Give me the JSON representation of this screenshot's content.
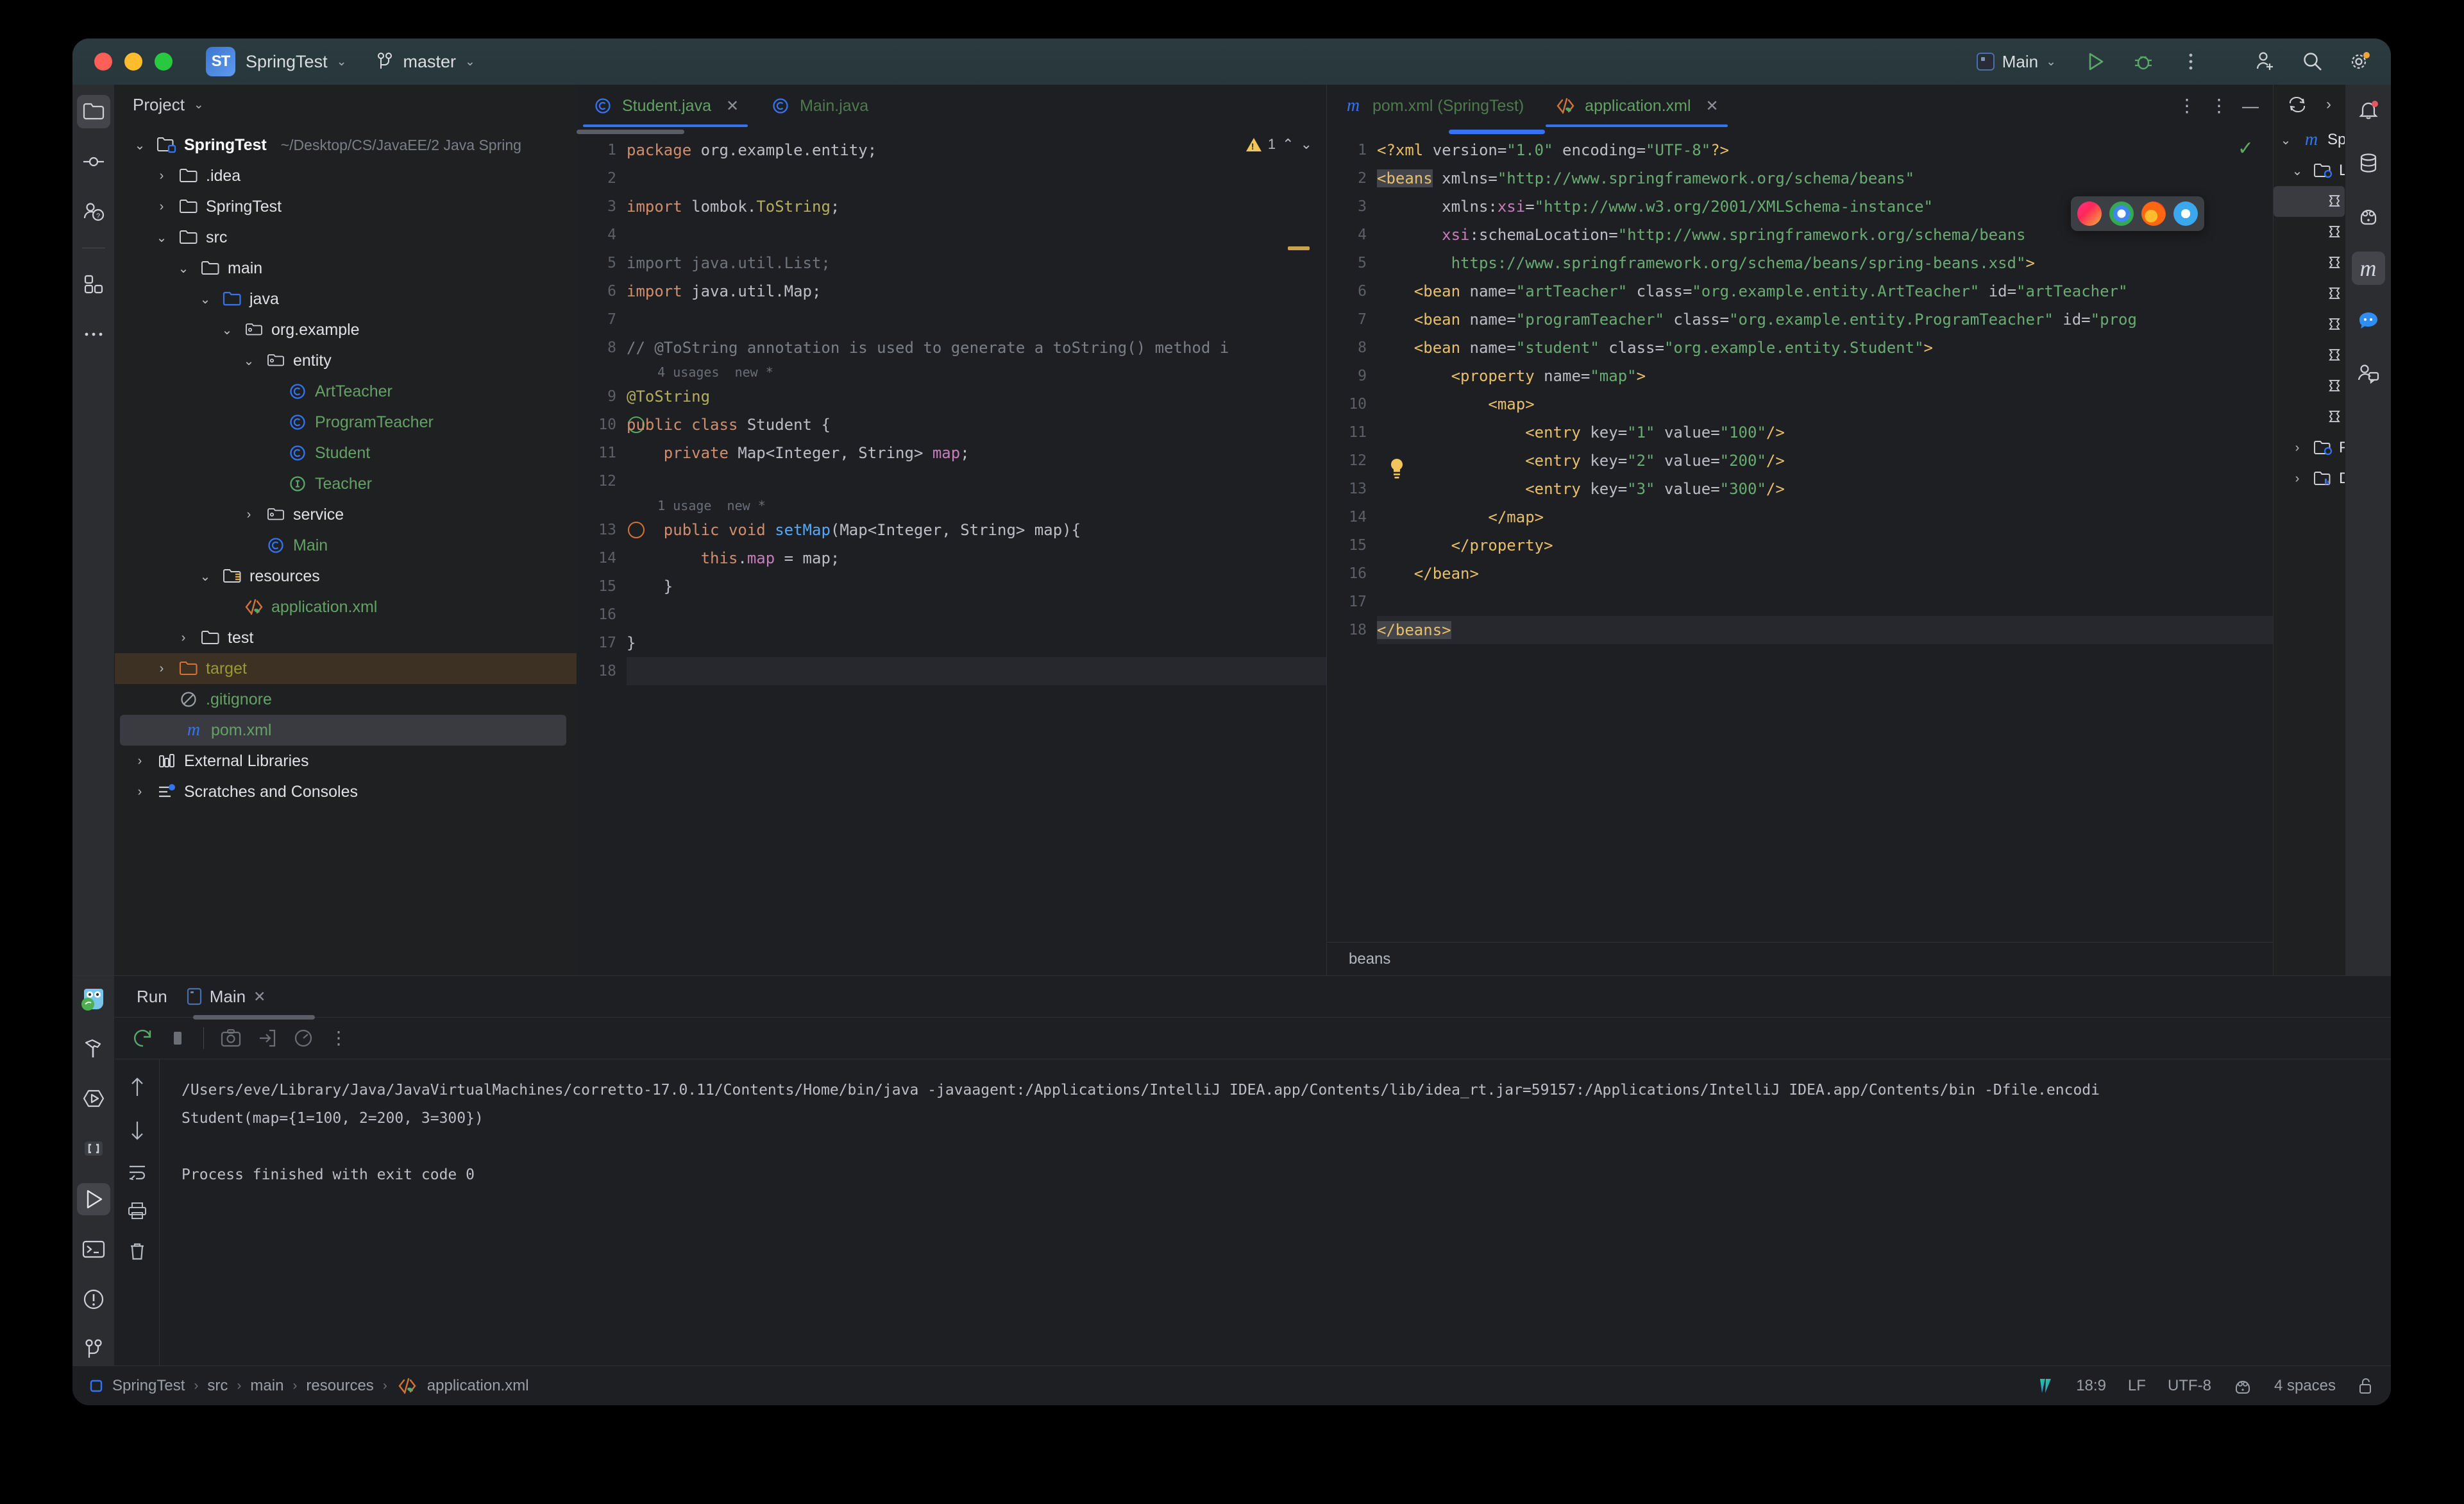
{
  "window": {
    "project_name": "SpringTest",
    "project_badge": "ST",
    "branch": "master",
    "run_config": "Main"
  },
  "project_panel": {
    "header": "Project",
    "tree": [
      {
        "label": "SpringTest",
        "path": "~/Desktop/CS/JavaEE/2 Java Spring",
        "depth": 0,
        "arrow": "v",
        "icon": "module-folder-icon",
        "style": "bold"
      },
      {
        "label": ".idea",
        "path": "",
        "depth": 1,
        "arrow": ">",
        "icon": "folder-icon",
        "style": "plain"
      },
      {
        "label": "SpringTest",
        "path": "",
        "depth": 1,
        "arrow": ">",
        "icon": "folder-icon",
        "style": "plain"
      },
      {
        "label": "src",
        "path": "",
        "depth": 1,
        "arrow": "v",
        "icon": "folder-icon",
        "style": "plain"
      },
      {
        "label": "main",
        "path": "",
        "depth": 2,
        "arrow": "v",
        "icon": "folder-icon",
        "style": "plain"
      },
      {
        "label": "java",
        "path": "",
        "depth": 3,
        "arrow": "v",
        "icon": "source-folder-icon",
        "style": "plain"
      },
      {
        "label": "org.example",
        "path": "",
        "depth": 4,
        "arrow": "v",
        "icon": "package-icon",
        "style": "plain"
      },
      {
        "label": "entity",
        "path": "",
        "depth": 5,
        "arrow": "v",
        "icon": "package-icon",
        "style": "plain"
      },
      {
        "label": "ArtTeacher",
        "path": "",
        "depth": 6,
        "arrow": "",
        "icon": "class-icon",
        "style": "green"
      },
      {
        "label": "ProgramTeacher",
        "path": "",
        "depth": 6,
        "arrow": "",
        "icon": "class-icon",
        "style": "green"
      },
      {
        "label": "Student",
        "path": "",
        "depth": 6,
        "arrow": "",
        "icon": "class-icon",
        "style": "green"
      },
      {
        "label": "Teacher",
        "path": "",
        "depth": 6,
        "arrow": "",
        "icon": "interface-icon",
        "style": "green"
      },
      {
        "label": "service",
        "path": "",
        "depth": 5,
        "arrow": ">",
        "icon": "package-icon",
        "style": "plain"
      },
      {
        "label": "Main",
        "path": "",
        "depth": 5,
        "arrow": "",
        "icon": "class-icon",
        "style": "green"
      },
      {
        "label": "resources",
        "path": "",
        "depth": 3,
        "arrow": "v",
        "icon": "resource-folder-icon",
        "style": "plain"
      },
      {
        "label": "application.xml",
        "path": "",
        "depth": 4,
        "arrow": "",
        "icon": "spring-xml-icon",
        "style": "green"
      },
      {
        "label": "test",
        "path": "",
        "depth": 2,
        "arrow": ">",
        "icon": "folder-icon",
        "style": "plain"
      },
      {
        "label": "target",
        "path": "",
        "depth": 1,
        "arrow": ">",
        "icon": "excluded-folder-icon",
        "style": "olive",
        "row": "sel-brown"
      },
      {
        "label": ".gitignore",
        "path": "",
        "depth": 1,
        "arrow": "",
        "icon": "gitignore-icon",
        "style": "green"
      },
      {
        "label": "pom.xml",
        "path": "",
        "depth": 1,
        "arrow": "",
        "icon": "maven-icon",
        "style": "green",
        "row": "sel-grey"
      },
      {
        "label": "External Libraries",
        "path": "",
        "depth": 0,
        "arrow": ">",
        "icon": "library-icon",
        "style": "plain"
      },
      {
        "label": "Scratches and Consoles",
        "path": "",
        "depth": 0,
        "arrow": ">",
        "icon": "scratches-icon",
        "style": "plain"
      }
    ]
  },
  "editor_left": {
    "tabs": [
      {
        "label": "Student.java",
        "icon": "class-icon",
        "active": true,
        "closable": true
      },
      {
        "label": "Main.java",
        "icon": "class-icon",
        "active": false,
        "closable": false
      }
    ],
    "inspection_count": "1",
    "lines": [
      {
        "n": "1",
        "html": "<span class='kw'>package</span> <span class='txt'>org.example.entity;</span>"
      },
      {
        "n": "2",
        "html": ""
      },
      {
        "n": "3",
        "html": "<span class='kw'>import</span> <span class='txt'>lombok.</span><span class='ann'>ToString</span><span class='txt'>;</span>"
      },
      {
        "n": "4",
        "html": ""
      },
      {
        "n": "5",
        "html": "<span class='dim'>import java.util.List;</span>"
      },
      {
        "n": "6",
        "html": "<span class='kw'>import</span> <span class='txt'>java.util.Map;</span>"
      },
      {
        "n": "7",
        "html": ""
      },
      {
        "n": "8",
        "html": "<span class='cmt'>// @ToString annotation is used to generate a toString() method i</span>"
      },
      {
        "n": "9",
        "html": "<span class='ann'>@ToString</span>",
        "hint": "4 usages  new *"
      },
      {
        "n": "10",
        "html": "<span class='kw'>public class</span> <span class='txt'>Student {</span>"
      },
      {
        "n": "11",
        "html": "    <span class='kw'>private</span> <span class='typ'>Map&lt;Integer, String&gt;</span> <span class='fld'>map</span><span class='txt'>;</span>"
      },
      {
        "n": "12",
        "html": ""
      },
      {
        "n": "13",
        "html": "    <span class='kw'>public void</span> <span class='mth'>setMap</span><span class='txt'>(Map&lt;Integer, String&gt; map){</span>",
        "hint": "1 usage  new *"
      },
      {
        "n": "14",
        "html": "        <span class='kw'>this</span><span class='txt'>.</span><span class='fld'>map</span> <span class='txt'>= map;</span>"
      },
      {
        "n": "15",
        "html": "    <span class='txt'>}</span>"
      },
      {
        "n": "16",
        "html": ""
      },
      {
        "n": "17",
        "html": "<span class='txt'>}</span>"
      },
      {
        "n": "18",
        "html": "",
        "highlight": true
      }
    ]
  },
  "editor_right": {
    "tabs": [
      {
        "label": "pom.xml (SpringTest)",
        "icon": "maven-icon",
        "active": false,
        "closable": false
      },
      {
        "label": "application.xml",
        "icon": "spring-xml-icon",
        "active": true,
        "closable": true
      }
    ],
    "breadcrumb": "beans",
    "lines": [
      {
        "n": "1",
        "html": "<span class='xdecl'>&lt;?xml</span> <span class='xattr'>version=</span><span class='xval'>\"1.0\"</span> <span class='xattr'>encoding=</span><span class='xval'>\"UTF-8\"</span><span class='xdecl'>?&gt;</span>"
      },
      {
        "n": "2",
        "html": "<span class='xtag xsel'>&lt;beans</span> <span class='xattr'>xmlns=</span><span class='xval'>\"http://www.springframework.org/schema/beans\"</span>"
      },
      {
        "n": "3",
        "html": "       <span class='xattr'>xmlns:</span><span class='xns'>xsi</span><span class='xattr'>=</span><span class='xval'>\"http://www.w3.org/2001/XMLSchema-instance\"</span>"
      },
      {
        "n": "4",
        "html": "       <span class='xns'>xsi</span><span class='xattr'>:schemaLocation=</span><span class='xval'>\"http://www.springframework.org/schema/beans</span>"
      },
      {
        "n": "5",
        "html": "        <span class='xval'>https://www.springframework.org/schema/beans/spring-beans.xsd\"</span><span class='xtag'>&gt;</span>"
      },
      {
        "n": "6",
        "html": "    <span class='xtag'>&lt;bean</span> <span class='xattr'>name=</span><span class='xval'>\"artTeacher\"</span> <span class='xattr'>class=</span><span class='xval'>\"org.example.entity.ArtTeacher\"</span> <span class='xattr'>id=</span><span class='xval'>\"artTeacher\"</span>"
      },
      {
        "n": "7",
        "html": "    <span class='xtag'>&lt;bean</span> <span class='xattr'>name=</span><span class='xval'>\"programTeacher\"</span> <span class='xattr'>class=</span><span class='xval'>\"org.example.entity.ProgramTeacher\"</span> <span class='xattr'>id=</span><span class='xval'>\"prog</span>"
      },
      {
        "n": "8",
        "html": "    <span class='xtag'>&lt;bean</span> <span class='xattr'>name=</span><span class='xval'>\"student\"</span> <span class='xattr'>class=</span><span class='xval'>\"org.example.entity.Student\"</span><span class='xtag'>&gt;</span>"
      },
      {
        "n": "9",
        "html": "        <span class='xtag'>&lt;property</span> <span class='xattr'>name=</span><span class='xval'>\"map\"</span><span class='xtag'>&gt;</span>"
      },
      {
        "n": "10",
        "html": "            <span class='xtag'>&lt;map&gt;</span>"
      },
      {
        "n": "11",
        "html": "                <span class='xtag'>&lt;entry</span> <span class='xattr'>key=</span><span class='xval'>\"1\"</span> <span class='xattr'>value=</span><span class='xval'>\"100\"</span><span class='xtag'>/&gt;</span>"
      },
      {
        "n": "12",
        "html": "                <span class='xtag'>&lt;entry</span> <span class='xattr'>key=</span><span class='xval'>\"2\"</span> <span class='xattr'>value=</span><span class='xval'>\"200\"</span><span class='xtag'>/&gt;</span>"
      },
      {
        "n": "13",
        "html": "                <span class='xtag'>&lt;entry</span> <span class='xattr'>key=</span><span class='xval'>\"3\"</span> <span class='xattr'>value=</span><span class='xval'>\"300\"</span><span class='xtag'>/&gt;</span>"
      },
      {
        "n": "14",
        "html": "            <span class='xtag'>&lt;/map&gt;</span>"
      },
      {
        "n": "15",
        "html": "        <span class='xtag'>&lt;/property&gt;</span>"
      },
      {
        "n": "16",
        "html": "    <span class='xtag'>&lt;/bean&gt;</span>"
      },
      {
        "n": "17",
        "html": ""
      },
      {
        "n": "18",
        "html": "<span class='xtag xsel'>&lt;/beans&gt;</span>",
        "highlight": true
      }
    ],
    "browser_popup": [
      "intellij-browser-icon",
      "chrome-browser-icon",
      "firefox-browser-icon",
      "safari-browser-icon"
    ]
  },
  "maven_panel": {
    "rows": [
      {
        "label": "Spri",
        "icon": "maven-icon",
        "depth": 0,
        "arrow": "v"
      },
      {
        "label": "L",
        "icon": "lifecycle-folder-icon",
        "depth": 1,
        "arrow": "v"
      },
      {
        "label": "",
        "icon": "phase-icon",
        "depth": 2,
        "arrow": "",
        "selected": true
      },
      {
        "label": "",
        "icon": "phase-icon",
        "depth": 2,
        "arrow": ""
      },
      {
        "label": "",
        "icon": "phase-icon",
        "depth": 2,
        "arrow": ""
      },
      {
        "label": "",
        "icon": "phase-icon",
        "depth": 2,
        "arrow": ""
      },
      {
        "label": "",
        "icon": "phase-icon",
        "depth": 2,
        "arrow": ""
      },
      {
        "label": "",
        "icon": "phase-icon",
        "depth": 2,
        "arrow": ""
      },
      {
        "label": "",
        "icon": "phase-icon",
        "depth": 2,
        "arrow": ""
      },
      {
        "label": "",
        "icon": "phase-icon",
        "depth": 2,
        "arrow": ""
      },
      {
        "label": "P",
        "icon": "plugins-folder-icon",
        "depth": 1,
        "arrow": ">"
      },
      {
        "label": "D",
        "icon": "dependencies-folder-icon",
        "depth": 1,
        "arrow": ">"
      }
    ]
  },
  "run_window": {
    "title": "Run",
    "tab_label": "Main",
    "console_lines": [
      "/Users/eve/Library/Java/JavaVirtualMachines/corretto-17.0.11/Contents/Home/bin/java -javaagent:/Applications/IntelliJ IDEA.app/Contents/lib/idea_rt.jar=59157:/Applications/IntelliJ IDEA.app/Contents/bin -Dfile.encodi",
      "Student(map={1=100, 2=200, 3=300})",
      "",
      "Process finished with exit code 0"
    ]
  },
  "status_bar": {
    "breadcrumbs": [
      "SpringTest",
      "src",
      "main",
      "resources",
      "application.xml"
    ],
    "caret": "18:9",
    "line_sep": "LF",
    "encoding": "UTF-8",
    "indent": "4 spaces"
  },
  "colors": {
    "accent": "#3574f0",
    "green_text": "#64a164",
    "xml_value": "#6aab73",
    "xml_tag": "#e8bf6a",
    "bg": "#1e1f22",
    "panel": "#2b2d30"
  }
}
